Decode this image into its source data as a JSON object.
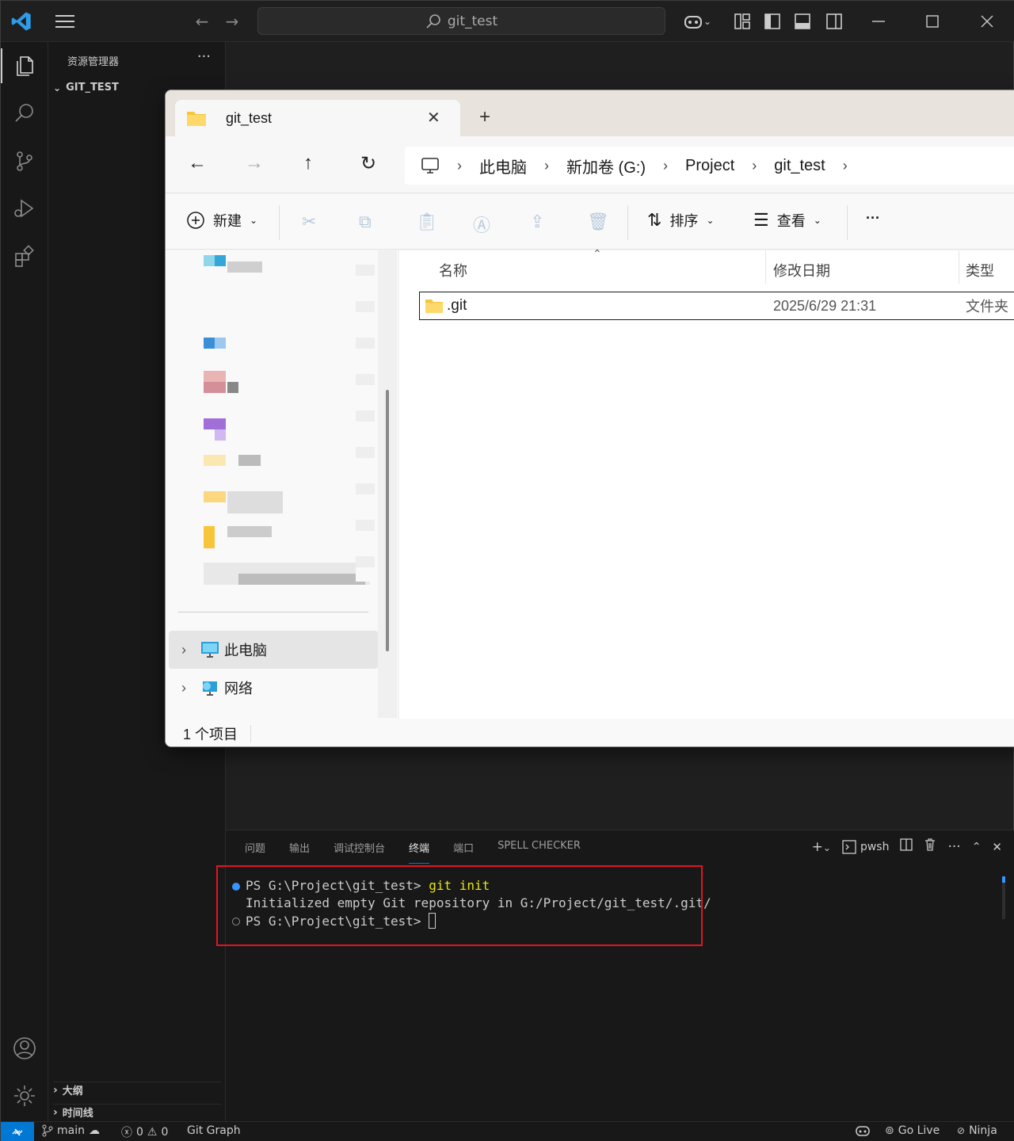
{
  "titlebar": {
    "search_text": "git_test"
  },
  "sidebar": {
    "title": "资源管理器",
    "more": "···",
    "folder": "GIT_TEST",
    "outline": "大纲",
    "timeline": "时间线"
  },
  "explorer": {
    "tab_title": "git_test",
    "breadcrumbs": [
      "此电脑",
      "新加卷 (G:)",
      "Project",
      "git_test"
    ],
    "toolbar": {
      "new_label": "新建",
      "sort_label": "排序",
      "view_label": "查看",
      "more": "···"
    },
    "columns": {
      "name": "名称",
      "modified": "修改日期",
      "type": "类型"
    },
    "files": [
      {
        "name": ".git",
        "modified": "2025/6/29 21:31",
        "type": "文件夹"
      }
    ],
    "nav": {
      "this_pc": "此电脑",
      "network": "网络"
    },
    "status": "1 个项目"
  },
  "panel": {
    "tabs": [
      "问题",
      "输出",
      "调试控制台",
      "终端",
      "端口",
      "SPELL CHECKER"
    ],
    "shell": "pwsh",
    "terminal": {
      "prompt1": "PS G:\\Project\\git_test> ",
      "command": "git init",
      "output": "Initialized empty Git repository in G:/Project/git_test/.git/",
      "prompt2": "PS G:\\Project\\git_test> "
    }
  },
  "statusbar": {
    "branch": "main",
    "errors": "0",
    "warnings": "0",
    "git_graph": "Git Graph",
    "go_live": "Go Live",
    "ninja": "Ninja"
  },
  "colors": {
    "accent": "#0078d4",
    "highlight_box": "#e81123",
    "command": "#e5e510"
  }
}
